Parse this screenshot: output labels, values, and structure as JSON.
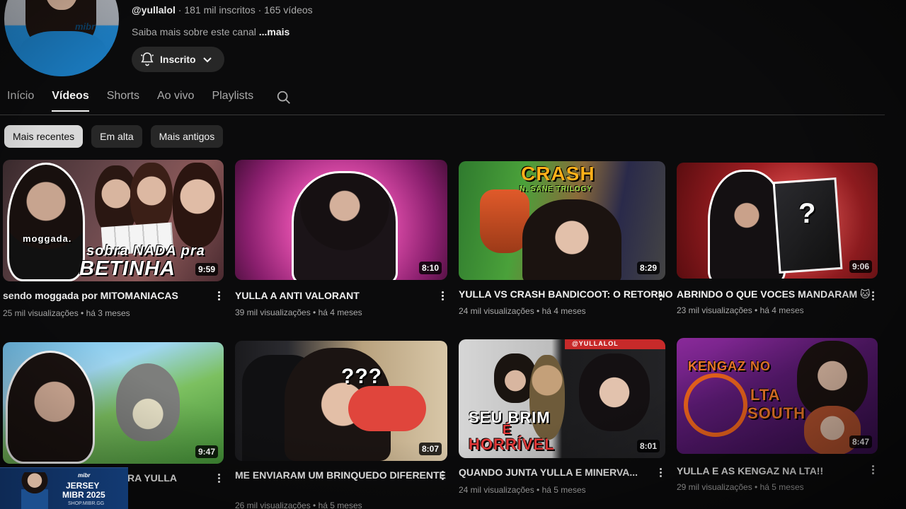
{
  "channel": {
    "handle": "@yullalol",
    "stats": " · 181 mil inscritos · 165 vídeos",
    "about": "Saiba mais sobre este canal ",
    "about_more": "...mais",
    "avatar_logo": "mibr",
    "subscribe_label": "Inscrito"
  },
  "tabs": [
    {
      "label": "Início"
    },
    {
      "label": "Vídeos"
    },
    {
      "label": "Shorts"
    },
    {
      "label": "Ao vivo"
    },
    {
      "label": "Playlists"
    }
  ],
  "chips": [
    {
      "label": "Mais recentes"
    },
    {
      "label": "Em alta"
    },
    {
      "label": "Mais antigos"
    }
  ],
  "videos": [
    {
      "title": "sendo moggada por MITOMANIACAS",
      "meta": "25 mil visualizações • há 3 meses",
      "duration": "9:59",
      "thumb_text_1": "moggada.",
      "thumb_text_2": "sobra NADA pra",
      "thumb_text_3": "BETINHA"
    },
    {
      "title": "YULLA A ANTI VALORANT",
      "meta": "39 mil visualizações • há 4 meses",
      "duration": "8:10"
    },
    {
      "title": "YULLA VS CRASH BANDICOOT: O RETORNO",
      "meta": "24 mil visualizações • há 4 meses",
      "duration": "8:29",
      "thumb_text_1": "CRASH",
      "thumb_text_2": "N. SANE TRILOGY"
    },
    {
      "title": "ABRINDO O QUE VOCES MANDARAM 🐱",
      "meta": "23 mil visualizações • há 4 meses",
      "duration": "9:06",
      "thumb_text_1": "?"
    },
    {
      "title": "RA YULLA",
      "meta": "",
      "duration": "9:47"
    },
    {
      "title": "ME ENVIARAM UM BRINQUEDO DIFERENTE",
      "meta": "26 mil visualizações • há 5 meses",
      "duration": "8:07",
      "thumb_text_1": "???"
    },
    {
      "title": "QUANDO JUNTA YULLA E MINERVA...",
      "meta": "24 mil visualizações • há 5 meses",
      "duration": "8:01",
      "thumb_text_1": "SEU BRIM",
      "thumb_text_2": "É",
      "thumb_text_3": "HORRÍVEL",
      "thumb_text_4": "@YULLALOL"
    },
    {
      "title": "YULLA E AS KENGAZ NA LTA!!",
      "meta": "29 mil visualizações • há 5 meses",
      "duration": "8:47",
      "thumb_text_1": "KENGAZ NO",
      "thumb_text_2": "LTA",
      "thumb_text_3": "SOUTH"
    }
  ],
  "ad": {
    "brand": "mibr",
    "line1": "JERSEY",
    "line2": "MIBR 2025",
    "line3": "SHOP.MIBR.GG"
  }
}
